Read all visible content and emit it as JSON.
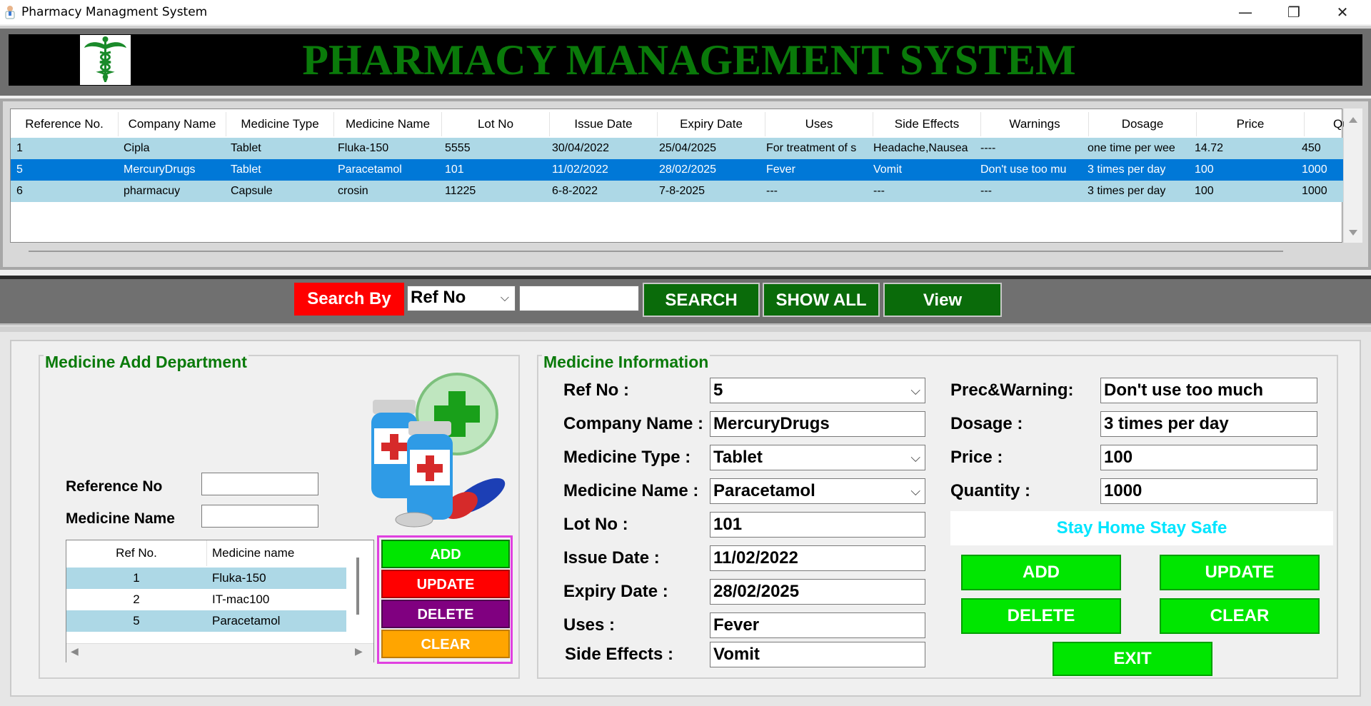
{
  "window": {
    "title": "Pharmacy Managment System",
    "min_glyph": "—",
    "restore_glyph": "❐",
    "close_glyph": "✕"
  },
  "header": {
    "title": "PHARMACY MANAGEMENT SYSTEM",
    "logo_icon": "caduceus-icon",
    "title_color": "#0a7a0a"
  },
  "table": {
    "columns": [
      "Reference No.",
      "Company Name",
      "Medicine Type",
      "Medicine Name",
      "Lot No",
      "Issue Date",
      "Expiry Date",
      "Uses",
      "Side Effects",
      "Warnings",
      "Dosage",
      "Price",
      "Qu"
    ],
    "rows": [
      {
        "cells": [
          "1",
          "Cipla",
          "Tablet",
          "Fluka-150",
          "5555",
          "30/04/2022",
          "25/04/2025",
          "For treatment of s",
          "Headache,Nausea",
          "----",
          "one time per wee",
          "14.72",
          "450"
        ],
        "selected": false
      },
      {
        "cells": [
          "5",
          "MercuryDrugs",
          "Tablet",
          "Paracetamol",
          "101",
          "11/02/2022",
          "28/02/2025",
          "Fever",
          "Vomit",
          "Don't use too mu",
          "3 times per day",
          "100",
          "1000"
        ],
        "selected": true
      },
      {
        "cells": [
          "6",
          "pharmacuy",
          "Capsule",
          "crosin",
          "11225",
          "6-8-2022",
          "7-8-2025",
          "---",
          "---",
          "---",
          "3 times per day",
          "100",
          "1000"
        ],
        "selected": false
      }
    ]
  },
  "search": {
    "label": "Search By",
    "by_value": "Ref No",
    "text_value": "",
    "search_btn": "SEARCH",
    "show_all_btn": "SHOW ALL",
    "view_btn": "View"
  },
  "add_dept": {
    "title": "Medicine Add Department",
    "ref_label": "Reference No",
    "ref_value": "",
    "name_label": "Medicine Name",
    "name_value": "",
    "grid_cols": [
      "Ref No.",
      "Medicine name"
    ],
    "grid_rows": [
      {
        "ref": "1",
        "name": "Fluka-150"
      },
      {
        "ref": "2",
        "name": "IT-mac100"
      },
      {
        "ref": "5",
        "name": "Paracetamol"
      }
    ],
    "btn_add": "ADD",
    "btn_update": "UPDATE",
    "btn_delete": "DELETE",
    "btn_clear": "CLEAR"
  },
  "info": {
    "title": "Medicine Information",
    "ref_label": "Ref No :",
    "ref_value": "5",
    "company_label": "Company Name :",
    "company_value": "MercuryDrugs",
    "type_label": "Medicine Type :",
    "type_value": "Tablet",
    "name_label": "Medicine Name :",
    "name_value": "Paracetamol",
    "lot_label": "Lot No :",
    "lot_value": "101",
    "issue_label": "Issue Date :",
    "issue_value": "11/02/2022",
    "expiry_label": "Expiry Date :",
    "expiry_value": "28/02/2025",
    "uses_label": "Uses :",
    "uses_value": "Fever",
    "side_label": "Side Effects :",
    "side_value": "Vomit",
    "warn_label": "Prec&Warning:",
    "warn_value": "Don't use too much",
    "dosage_label": "Dosage :",
    "dosage_value": "3 times per day",
    "price_label": "Price :",
    "price_value": "100",
    "qty_label": "Quantity :",
    "qty_value": "1000",
    "banner": "Stay Home Stay Safe",
    "btn_add": "ADD",
    "btn_update": "UPDATE",
    "btn_delete": "DELETE",
    "btn_clear": "CLEAR",
    "btn_exit": "EXIT"
  },
  "colors": {
    "accent_green": "#00e600",
    "dark_green": "#0a6b0a",
    "search_red": "#ff0000",
    "row_light": "#add8e6",
    "row_selected": "#0078d7",
    "banner_text": "#00e5ff"
  }
}
